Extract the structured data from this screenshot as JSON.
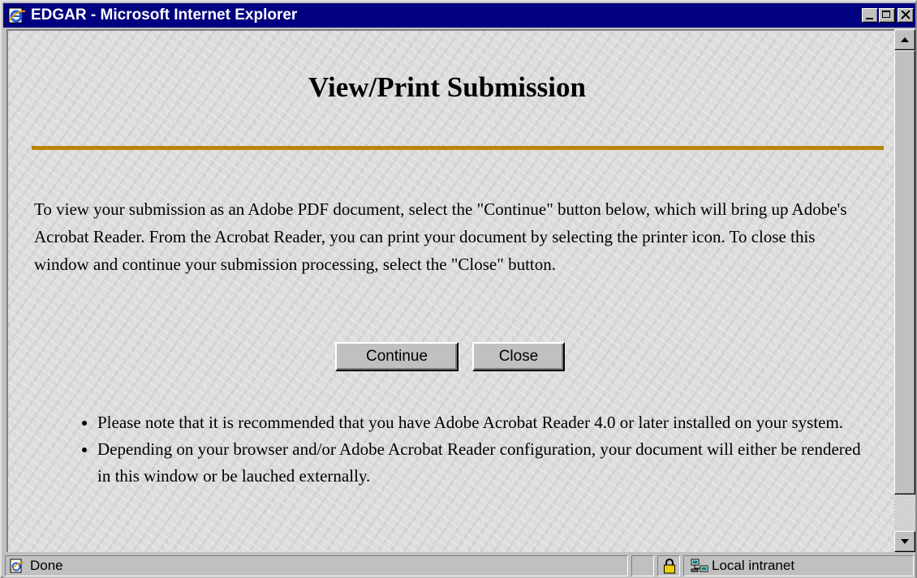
{
  "window": {
    "title": "EDGAR - Microsoft Internet Explorer",
    "icon": "ie-icon",
    "titlebar_color": "#000080"
  },
  "page": {
    "title": "View/Print Submission",
    "rule_color": "#b8860b",
    "intro": "To view your submission as an Adobe PDF document, select the \"Continue\" button below, which will bring up Adobe's Acrobat Reader. From the Acrobat Reader, you can print your document by selecting the printer icon. To close this window and continue your submission processing, select the \"Close\" button.",
    "buttons": {
      "continue": "Continue",
      "close": "Close"
    },
    "notes": [
      "Please note that it is recommended that you have Adobe Acrobat Reader 4.0 or later installed on your system.",
      "Depending on your browser and/or Adobe Acrobat Reader configuration, your document will either be rendered in this window or be lauched externally."
    ]
  },
  "status": {
    "text": "Done",
    "zone": "Local intranet",
    "icons": [
      "ie-page-icon",
      "lock-icon",
      "intranet-icon"
    ]
  }
}
